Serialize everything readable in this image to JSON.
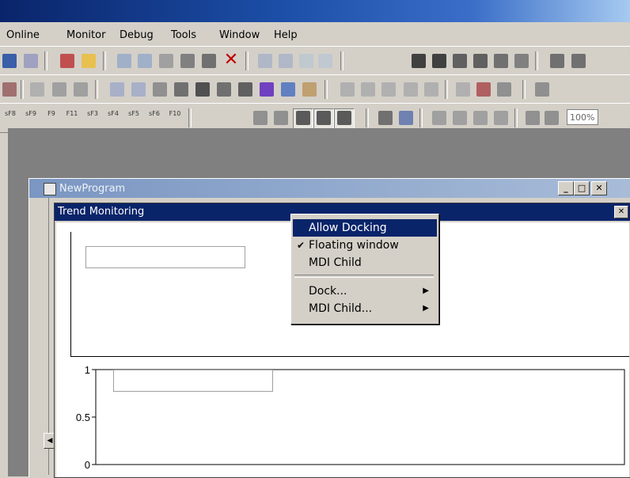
{
  "menubar": {
    "items": [
      {
        "label": "Online",
        "key": "O"
      },
      {
        "label": "Monitor",
        "key": "M"
      },
      {
        "label": "Debug",
        "key": "D"
      },
      {
        "label": "Tools",
        "key": "T"
      },
      {
        "label": "Window",
        "key": "W"
      },
      {
        "label": "Help",
        "key": "H"
      }
    ]
  },
  "toolbars": {
    "zoom": "100%",
    "fkeys": [
      "sF8",
      "sF9",
      "F9",
      "F11",
      "sF3",
      "sF4",
      "sF5",
      "sF6",
      "F10"
    ]
  },
  "program_window": {
    "title": "NewProgram"
  },
  "trend_window": {
    "title": "Trend Monitoring"
  },
  "context_menu": {
    "items": [
      {
        "label": "Allow Docking",
        "checked": false,
        "submenu": false,
        "highlighted": true
      },
      {
        "label": "Floating window",
        "checked": true,
        "submenu": false,
        "highlighted": false
      },
      {
        "label": "MDI Child",
        "checked": false,
        "submenu": false,
        "highlighted": false
      },
      {
        "label": "Dock...",
        "checked": false,
        "submenu": true,
        "highlighted": false
      },
      {
        "label": "MDI Child...",
        "checked": false,
        "submenu": true,
        "highlighted": false
      }
    ]
  },
  "chart_data": {
    "type": "line",
    "yticks": [
      "1",
      "0.5",
      "0"
    ],
    "ylim": [
      0,
      1
    ],
    "series": []
  }
}
